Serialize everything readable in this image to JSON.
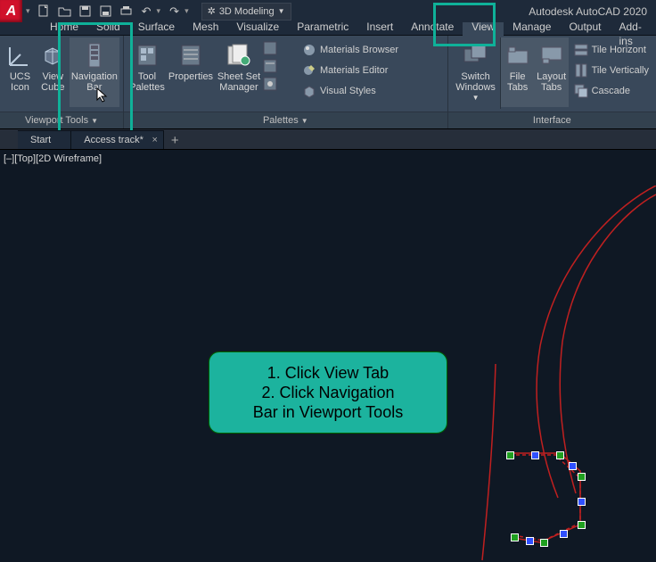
{
  "app": {
    "title": "Autodesk AutoCAD 2020",
    "logo": "A"
  },
  "workspace": {
    "label": "3D Modeling"
  },
  "menu": {
    "items": [
      "Home",
      "Solid",
      "Surface",
      "Mesh",
      "Visualize",
      "Parametric",
      "Insert",
      "Annotate",
      "View",
      "Manage",
      "Output",
      "Add-ins",
      "A"
    ],
    "active": "View"
  },
  "ribbon": {
    "viewport_tools": {
      "title": "Viewport Tools",
      "ucs": "UCS\nIcon",
      "viewcube": "View\nCube",
      "navbar": "Navigation\nBar"
    },
    "palettes": {
      "title": "Palettes",
      "tool": "Tool\nPalettes",
      "props": "Properties",
      "sheet": "Sheet Set\nManager",
      "mat_browser": "Materials Browser",
      "mat_editor": "Materials Editor",
      "vis_styles": "Visual Styles"
    },
    "other": {
      "switch": "Switch\nWindows",
      "file_tabs": "File\nTabs",
      "layout_tabs": "Layout\nTabs"
    },
    "interface": {
      "title": "Interface",
      "tile_h": "Tile Horizont",
      "tile_v": "Tile Vertically",
      "cascade": "Cascade"
    }
  },
  "tabs": {
    "start": "Start",
    "file": "Access track*"
  },
  "viewport": {
    "label": "[–][Top][2D Wireframe]"
  },
  "callout": {
    "line1": "1. Click View Tab",
    "line2": "2. Click Navigation",
    "line3": "Bar in Viewport Tools"
  }
}
